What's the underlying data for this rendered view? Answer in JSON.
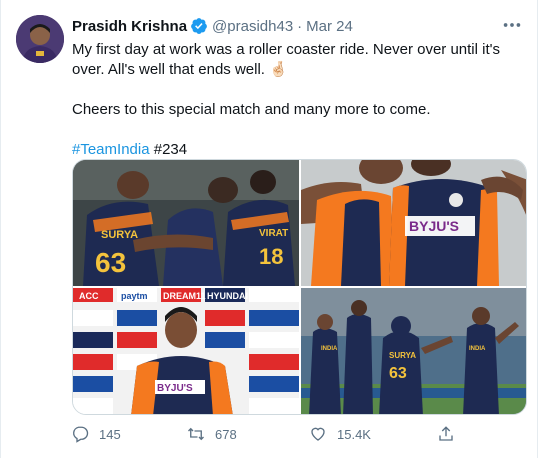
{
  "tweet": {
    "author_name": "Prasidh Krishna",
    "handle": "@prasidh43",
    "separator": "·",
    "date": "Mar 24",
    "text_line1": "My first day at work was a roller coaster ride. Never over until it's over. All's well that ends well. 🤞🏻",
    "text_line2": "Cheers to this special match and many more to come.",
    "hashtag": "#TeamIndia",
    "text_after_hashtag": " #234"
  },
  "photos": [
    {
      "jersey_name": "SURYA",
      "jersey_number": "63",
      "jersey_name2": "VIRAT",
      "jersey_number2": "18"
    },
    {
      "sponsor": "BYJU'S"
    },
    {
      "ads": [
        "ACC",
        "paytm",
        "DREAM11",
        "HYUNDAI"
      ],
      "sponsor": "BYJU'S"
    },
    {
      "jersey_name": "SURYA",
      "jersey_number": "63",
      "side_text": "INDIA"
    }
  ],
  "actions": {
    "reply_count": "145",
    "retweet_count": "678",
    "like_count": "15.4K"
  },
  "colors": {
    "link": "#1b95e0",
    "muted": "#5b7083",
    "verified": "#1d9bf0",
    "jersey_navy": "#1e2a52",
    "jersey_orange": "#f4791f"
  }
}
